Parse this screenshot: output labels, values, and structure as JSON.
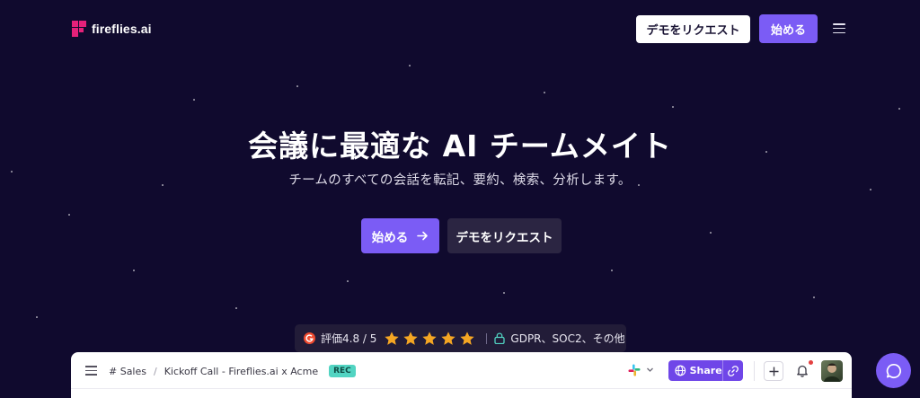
{
  "header": {
    "logo_text": "fireflies.ai",
    "demo_button": "デモをリクエスト",
    "start_button": "始める"
  },
  "hero": {
    "title": "会議に最適な AI チームメイト",
    "subtitle": "チームのすべての会話を転記、要約、検索、分析します。",
    "cta_start": "始める",
    "cta_demo": "デモをリクエスト"
  },
  "rating": {
    "score_text": "評価4.8 / 5",
    "stars": 5,
    "compliance_text": "GDPR、SOC2、その他"
  },
  "app_preview": {
    "channel": "# Sales",
    "separator": "/",
    "meeting_title": "Kickoff Call - Fireflies.ai x Acme",
    "rec_badge": "REC",
    "share_label": "Share"
  },
  "colors": {
    "background": "#100a2e",
    "accent": "#7b5cf5",
    "star": "#f5a623",
    "logo_pink": "#e5217a"
  },
  "icons": {
    "logo": "fireflies-logo-icon",
    "menu": "hamburger-menu-icon",
    "arrow": "arrow-right-icon",
    "g2": "g2-logo-icon",
    "star": "star-icon",
    "lock": "lock-icon",
    "slack": "slack-icon",
    "globe": "globe-icon",
    "link": "link-icon",
    "plus": "plus-icon",
    "bell": "bell-icon",
    "chat": "chat-bubble-icon"
  }
}
